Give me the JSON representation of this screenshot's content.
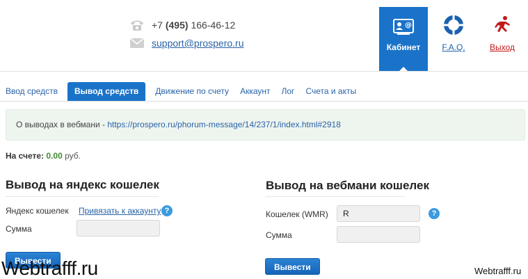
{
  "header": {
    "phone_prefix": "+7",
    "phone_code": "(495)",
    "phone_number": "166-46-12",
    "email": "support@prospero.ru",
    "nav": {
      "cabinet": "Кабинет",
      "faq": "F.A.Q.",
      "logout": "Выход"
    }
  },
  "tabs": [
    {
      "label": "Ввод средств",
      "active": false
    },
    {
      "label": "Вывод средств",
      "active": true
    },
    {
      "label": "Движение по счету",
      "active": false
    },
    {
      "label": "Аккаунт",
      "active": false
    },
    {
      "label": "Лог",
      "active": false
    },
    {
      "label": "Счета и акты",
      "active": false
    }
  ],
  "notice": {
    "text": "О выводах в вебмани - ",
    "link": "https://prospero.ru/phorum-message/14/237/1/index.html#2918"
  },
  "balance": {
    "label": "На счете:",
    "value": "0.00",
    "currency": "руб."
  },
  "yandex": {
    "title": "Вывод на яндекс кошелек",
    "wallet_label": "Яндекс кошелек",
    "bind_link": "Привязать к аккаунту",
    "sum_label": "Сумма",
    "sum_value": "",
    "button": "Вывести"
  },
  "webmoney": {
    "title": "Вывод на вебмани кошелек",
    "wallet_label": "Кошелек (WMR)",
    "wallet_value": "R",
    "sum_label": "Сумма",
    "sum_value": "",
    "button": "Вывести"
  },
  "help_glyph": "?",
  "watermarks": {
    "big": "Webtrafff.ru",
    "small": "Webtrafff.ru"
  },
  "colors": {
    "accent": "#1a73c9",
    "link": "#2a63a8",
    "logout": "#c01a1a",
    "balance": "#3f8b2f"
  }
}
